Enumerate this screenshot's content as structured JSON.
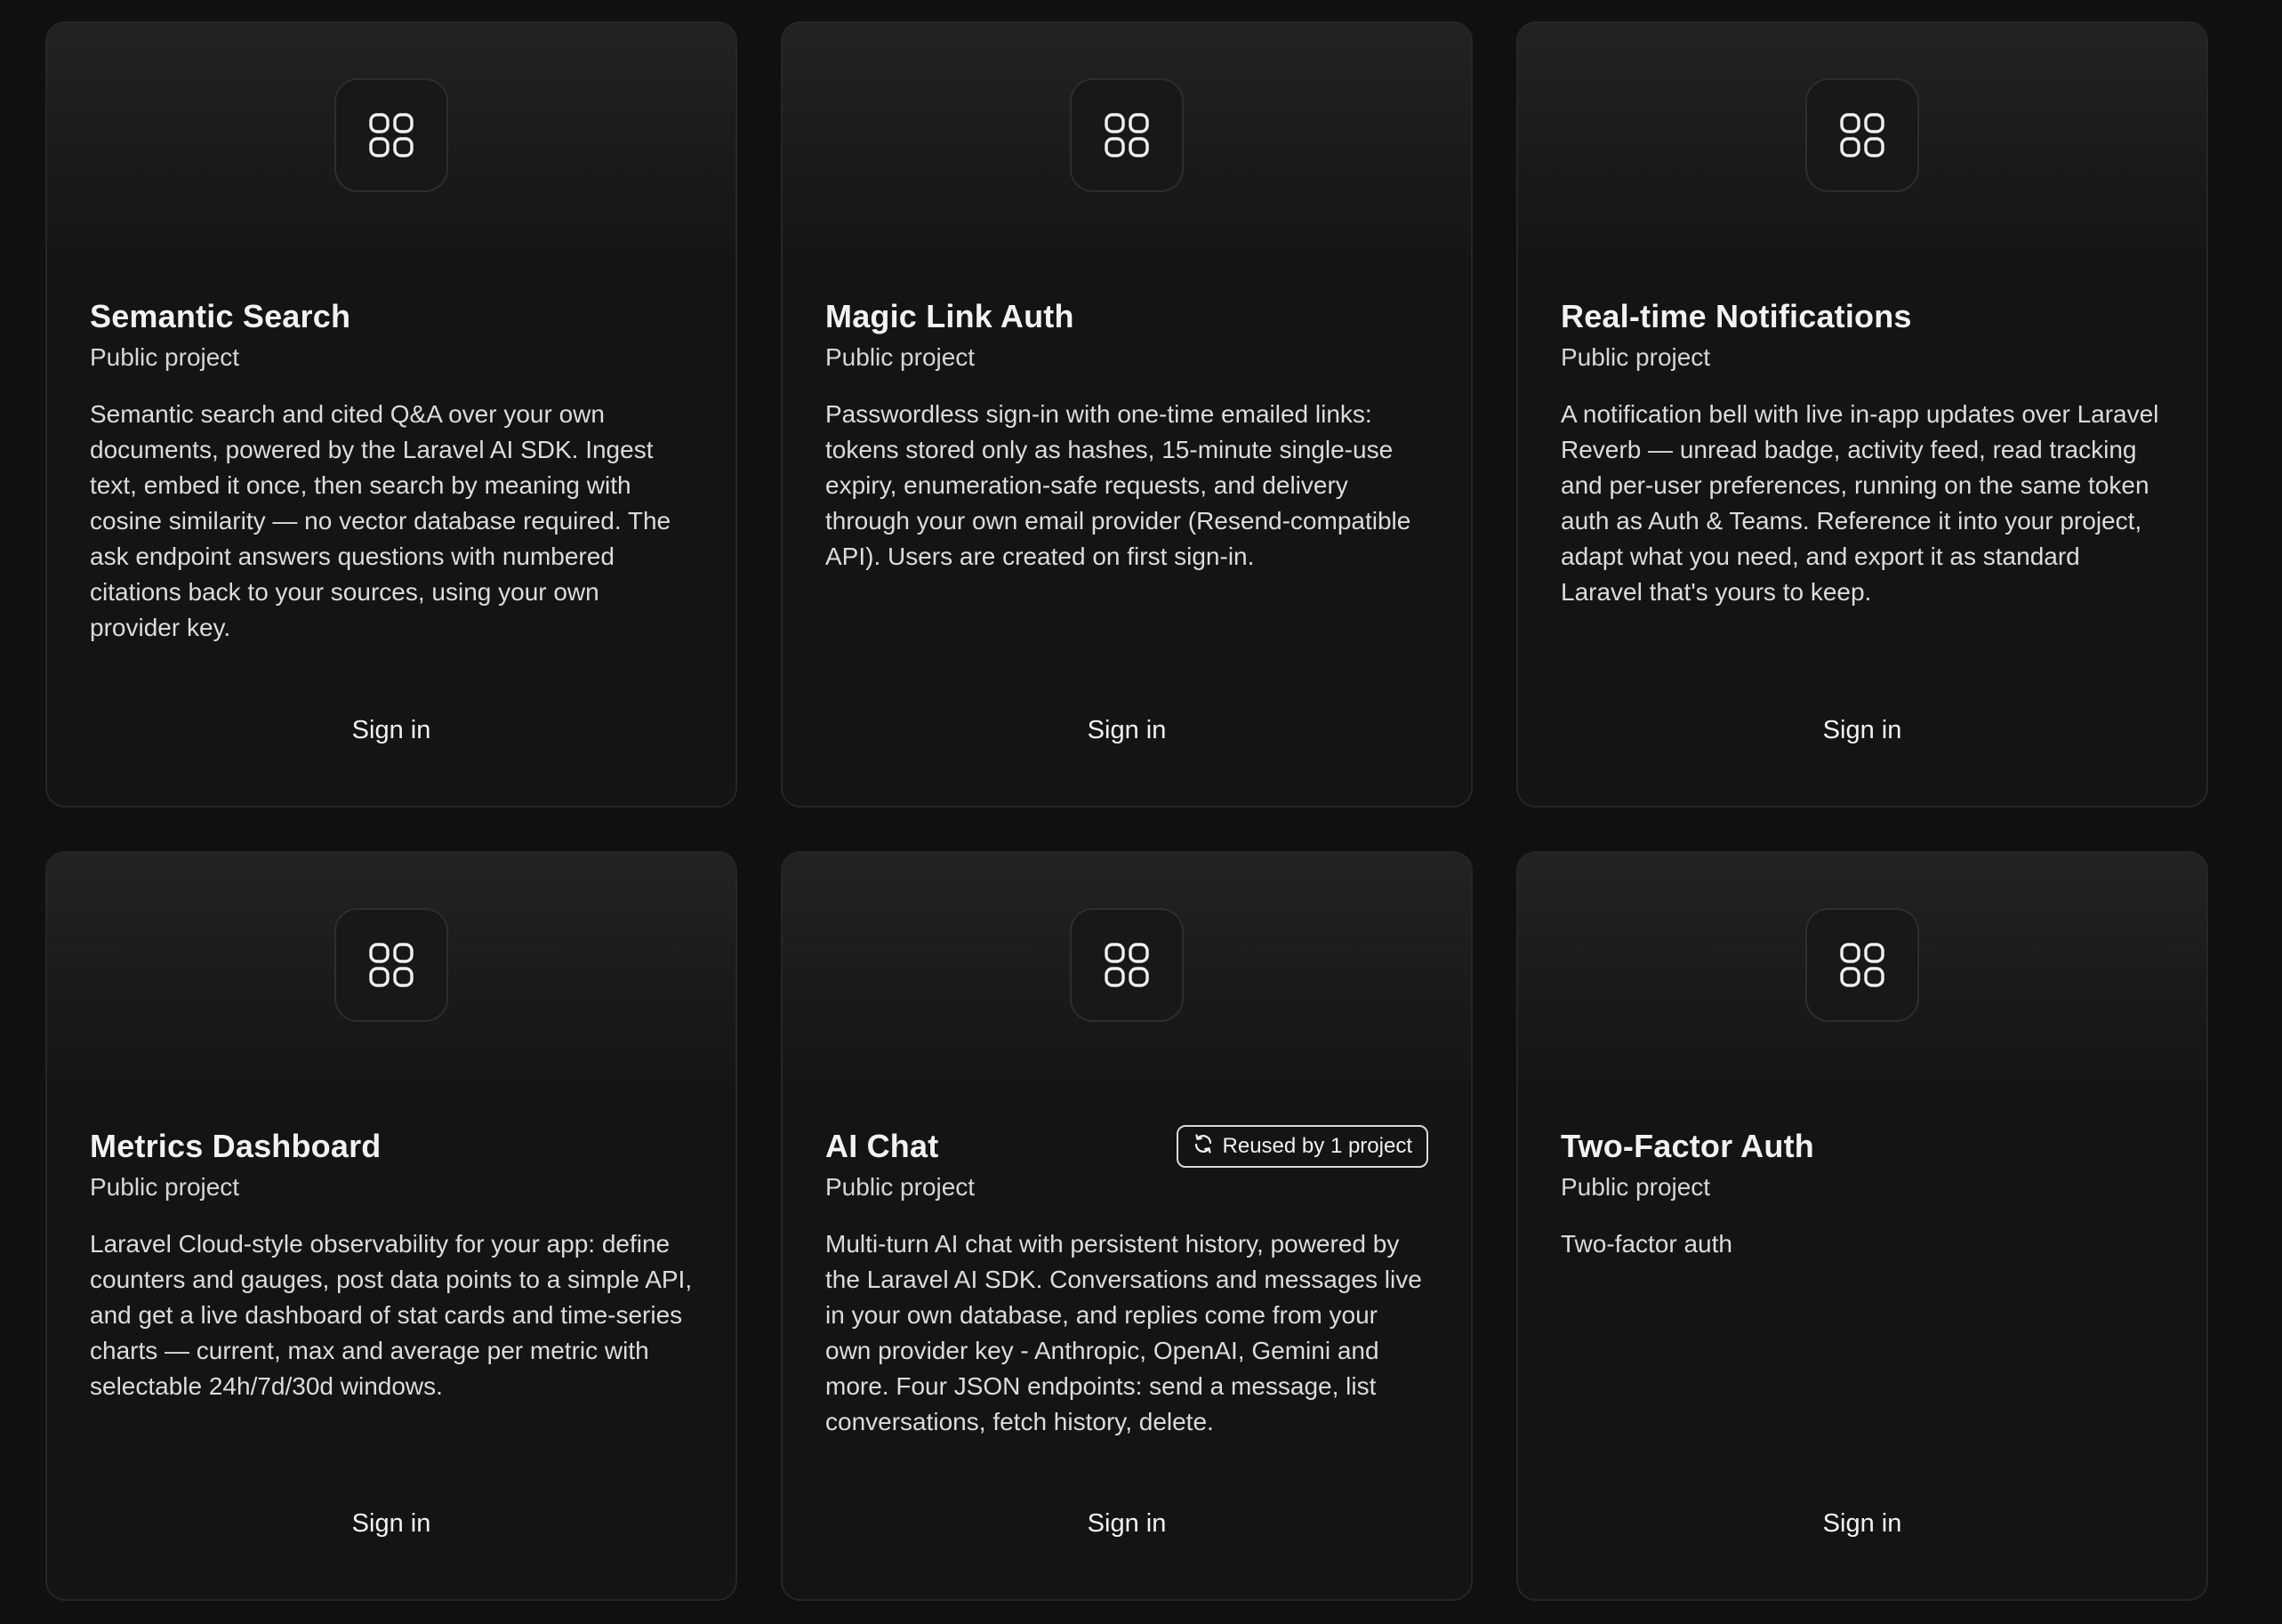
{
  "cards": [
    {
      "title": "Semantic Search",
      "subtitle": "Public project",
      "description": "Semantic search and cited Q&A over your own documents, powered by the Laravel AI SDK. Ingest text, embed it once, then search by meaning with cosine similarity — no vector database required. The ask endpoint answers questions with numbered citations back to your sources, using your own provider key.",
      "action": "Sign in",
      "icon": "grid-icon"
    },
    {
      "title": "Magic Link Auth",
      "subtitle": "Public project",
      "description": "Passwordless sign-in with one-time emailed links: tokens stored only as hashes, 15-minute single-use expiry, enumeration-safe requests, and delivery through your own email provider (Resend-compatible API). Users are created on first sign-in.",
      "action": "Sign in",
      "icon": "grid-icon"
    },
    {
      "title": "Real-time Notifications",
      "subtitle": "Public project",
      "description": "A notification bell with live in-app updates over Laravel Reverb — unread badge, activity feed, read tracking and per-user preferences, running on the same token auth as Auth & Teams. Reference it into your project, adapt what you need, and export it as standard Laravel that's yours to keep.",
      "action": "Sign in",
      "icon": "grid-icon"
    },
    {
      "title": "Metrics Dashboard",
      "subtitle": "Public project",
      "description": "Laravel Cloud-style observability for your app: define counters and gauges, post data points to a simple API, and get a live dashboard of stat cards and time-series charts — current, max and average per metric with selectable 24h/7d/30d windows.",
      "action": "Sign in",
      "icon": "grid-icon"
    },
    {
      "title": "AI Chat",
      "subtitle": "Public project",
      "badge": "Reused by 1 project",
      "description": "Multi-turn AI chat with persistent history, powered by the Laravel AI SDK. Conversations and messages live in your own database, and replies come from your own provider key - Anthropic, OpenAI, Gemini and more. Four JSON endpoints: send a message, list conversations, fetch history, delete.",
      "action": "Sign in",
      "icon": "grid-icon"
    },
    {
      "title": "Two-Factor Auth",
      "subtitle": "Public project",
      "description": "Two-factor auth",
      "action": "Sign in",
      "icon": "grid-icon"
    }
  ]
}
